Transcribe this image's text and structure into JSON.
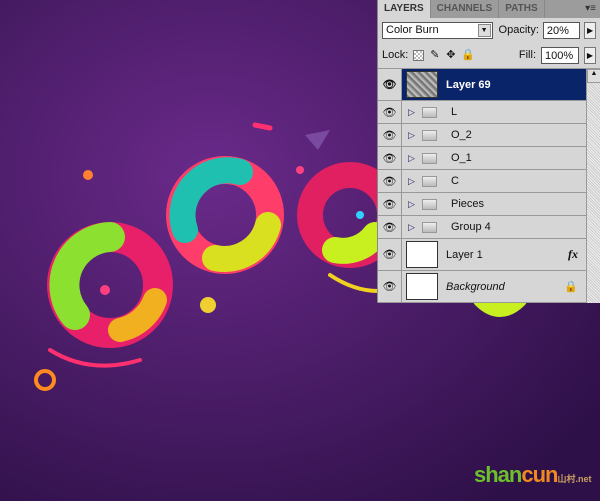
{
  "panel": {
    "tabs": [
      {
        "label": "LAYERS",
        "active": true
      },
      {
        "label": "CHANNELS",
        "active": false
      },
      {
        "label": "PATHS",
        "active": false
      }
    ],
    "menu_icon": "panel-menu-icon",
    "blend_mode": "Color Burn",
    "opacity_label": "Opacity:",
    "opacity_value": "20%",
    "lock_label": "Lock:",
    "fill_label": "Fill:",
    "fill_value": "100%",
    "layers": [
      {
        "name": "Layer 69",
        "type": "layer",
        "selected": true
      },
      {
        "name": "L",
        "type": "group"
      },
      {
        "name": "O_2",
        "type": "group"
      },
      {
        "name": "O_1",
        "type": "group"
      },
      {
        "name": "C",
        "type": "group"
      },
      {
        "name": "Pieces",
        "type": "group"
      },
      {
        "name": "Group 4",
        "type": "group"
      },
      {
        "name": "Layer 1",
        "type": "layer",
        "fx": "fx"
      },
      {
        "name": "Background",
        "type": "layer",
        "locked": true
      }
    ]
  },
  "watermark": {
    "text1": "shan",
    "text2": "cun",
    "text3": "山村.net"
  },
  "colors": {
    "selected": "#0a246a",
    "background": "#3a1650"
  }
}
